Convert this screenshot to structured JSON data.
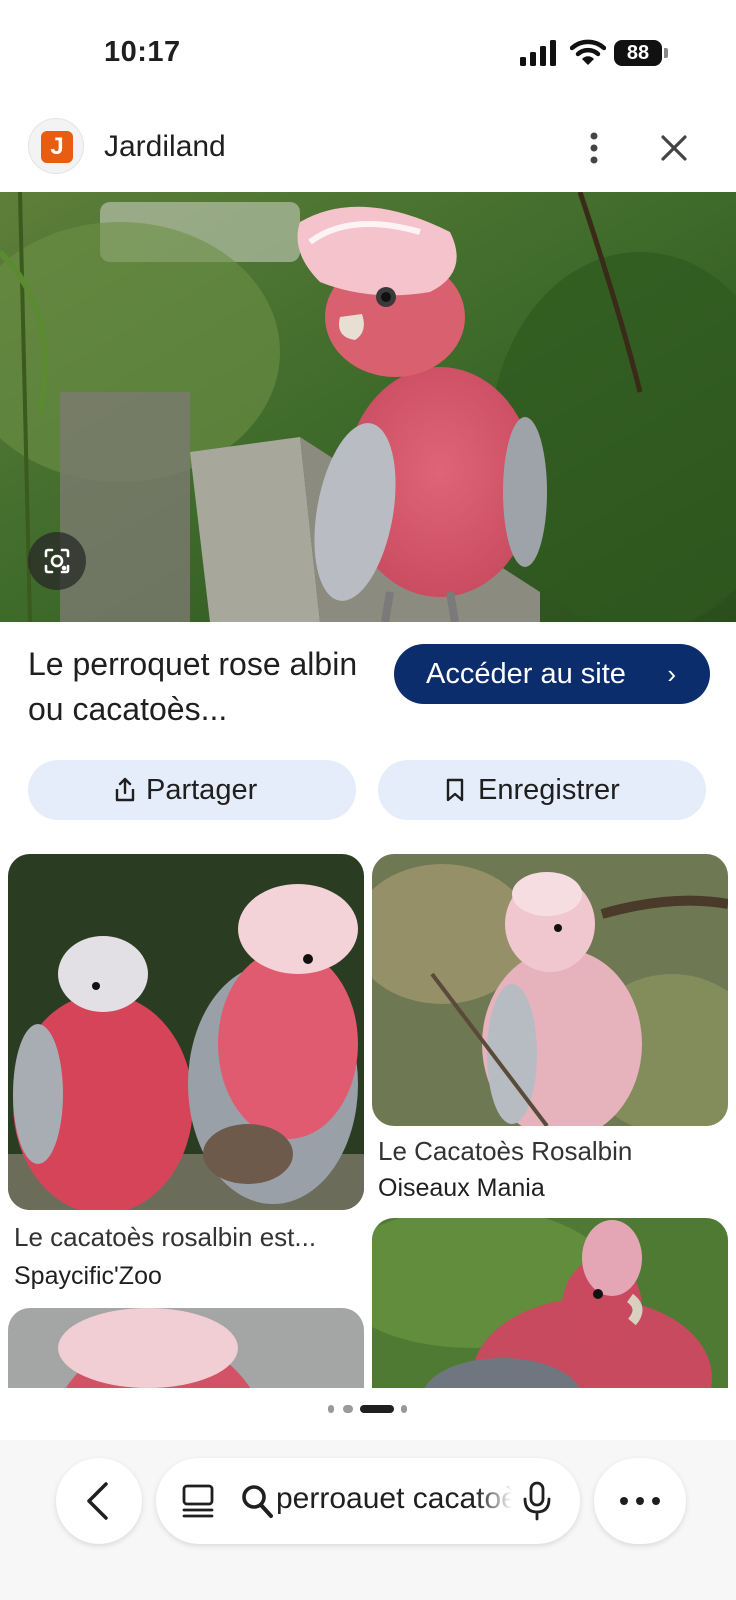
{
  "status_bar": {
    "time": "10:17",
    "battery_level": "88",
    "icons": [
      "cellular-signal-icon",
      "wifi-icon",
      "battery-icon"
    ]
  },
  "header": {
    "favicon_letter": "J",
    "favicon_color": "#e85d12",
    "site_name": "Jardiland",
    "icons": [
      "more-vertical-icon",
      "close-icon"
    ]
  },
  "result": {
    "title": "Le perroquet rose albin ou cacatoès...",
    "visit_label": "Accéder au site",
    "visit_chevron": "›",
    "share_label": "Partager",
    "save_label": "Enregistrer",
    "accent_color": "#0b2d6b"
  },
  "related": [
    {
      "title": "Le cacatoès rosalbin est...",
      "source": "Spaycific'Zoo"
    },
    {
      "title": "Le Cacatoès Rosalbin",
      "source": "Oiseaux Mania"
    }
  ],
  "pager": {
    "page_count": 4,
    "active_index": 2
  },
  "bottom_bar": {
    "search_query": "perroauet cacatoès",
    "icons": [
      "back-chevron-icon",
      "tabs-icon",
      "search-icon",
      "microphone-icon",
      "more-horizontal-icon"
    ]
  }
}
